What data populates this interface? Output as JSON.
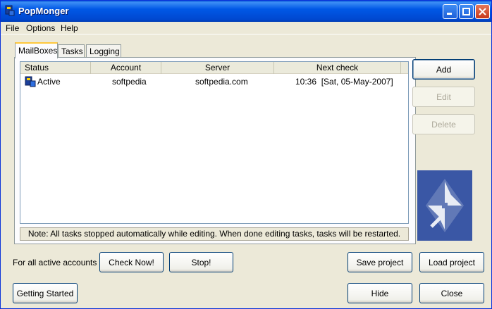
{
  "window": {
    "title": "PopMonger"
  },
  "menu": {
    "file": "File",
    "options": "Options",
    "help": "Help"
  },
  "tabs": [
    {
      "label": "MailBoxes"
    },
    {
      "label": "Tasks"
    },
    {
      "label": "Logging"
    }
  ],
  "mailboxes": {
    "columns": {
      "status": "Status",
      "account": "Account",
      "server": "Server",
      "next_check": "Next check"
    },
    "rows": [
      {
        "status": "Active",
        "account": "softpedia",
        "server": "softpedia.com",
        "next_check": "10:36  [Sat, 05-May-2007]"
      }
    ],
    "note": "Note: All tasks stopped automatically while editing. When done editing tasks, tasks will be restarted."
  },
  "side_buttons": {
    "add": "Add",
    "edit": "Edit",
    "delete": "Delete"
  },
  "bottom": {
    "for_all_label": "For all active accounts",
    "check_now": "Check Now!",
    "stop": "Stop!",
    "save_project": "Save project",
    "load_project": "Load project",
    "getting_started": "Getting Started",
    "hide": "Hide",
    "close": "Close"
  },
  "colors": {
    "titlebar": "#0058e6",
    "face": "#ece9d8",
    "logo_bg": "#3a57a5"
  },
  "icons": {
    "app": "popmonger-app-icon",
    "status": "mailbox-active-icon",
    "logo": "arrows-logo-icon"
  }
}
